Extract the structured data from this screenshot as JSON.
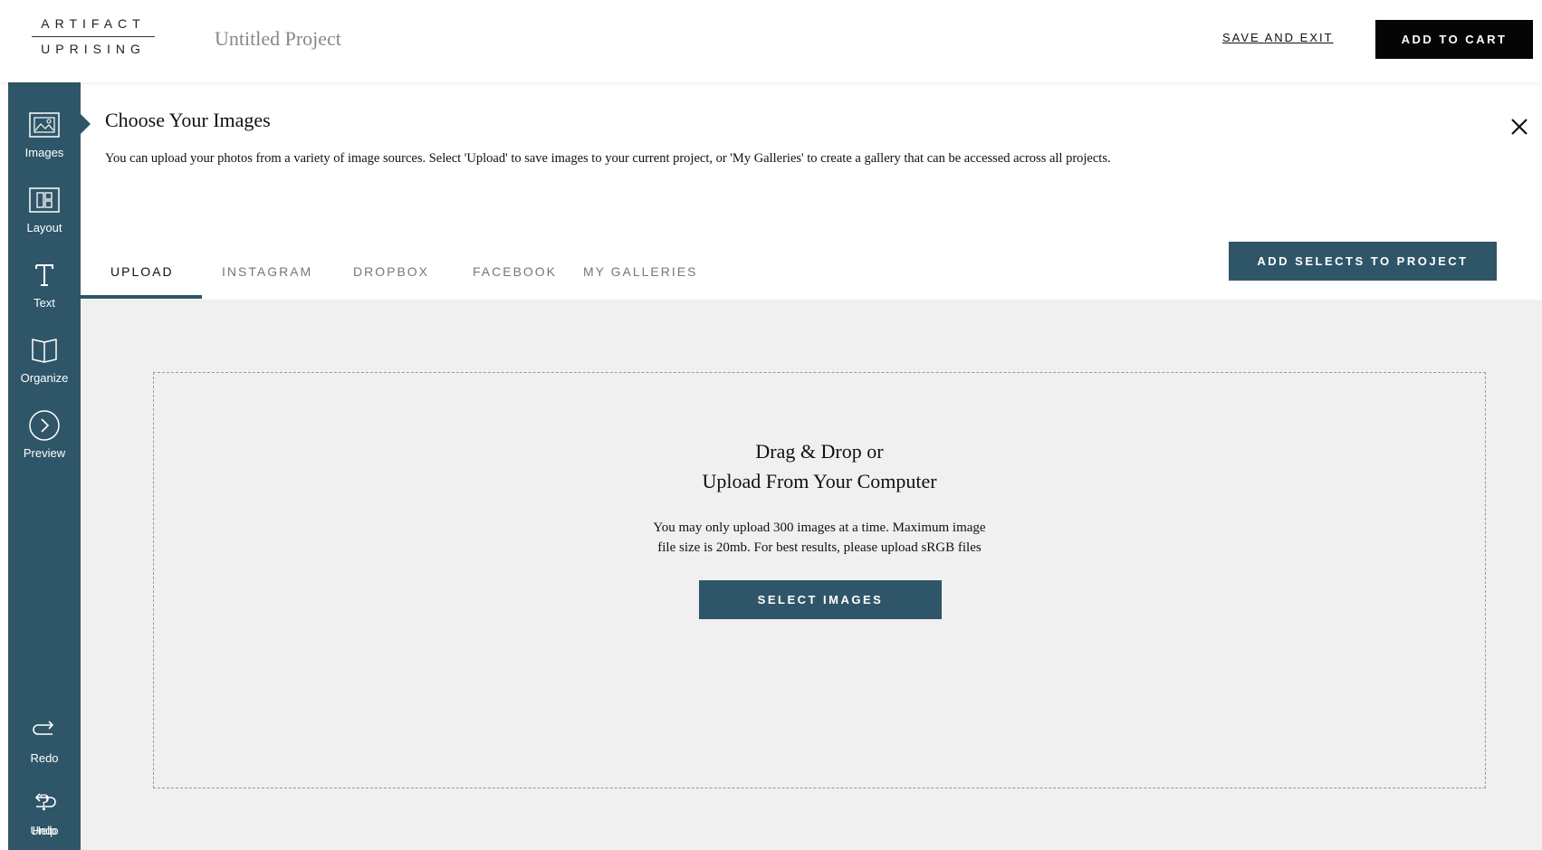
{
  "brand": {
    "logo_top": "ARTIFACT",
    "logo_bottom": "UPRISING"
  },
  "header": {
    "project_title": "Untitled Project",
    "save_exit_label": "SAVE AND EXIT",
    "add_to_cart_label": "ADD TO CART"
  },
  "sidebar": {
    "items": [
      {
        "label": "Images",
        "icon": "image-icon"
      },
      {
        "label": "Layout",
        "icon": "layout-icon"
      },
      {
        "label": "Text",
        "icon": "text-icon"
      },
      {
        "label": "Organize",
        "icon": "book-icon"
      },
      {
        "label": "Preview",
        "icon": "preview-icon"
      },
      {
        "label": "Redo",
        "icon": "redo-icon"
      },
      {
        "label": "Undo",
        "icon": "undo-icon"
      },
      {
        "label": "Help",
        "icon": "help-icon"
      }
    ],
    "active_item": "Images"
  },
  "panel": {
    "title": "Choose Your Images",
    "description": "You can upload your photos from a variety of image sources. Select 'Upload' to save images to your current project, or 'My Galleries' to create a gallery that can be accessed across all projects.",
    "tabs": [
      "UPLOAD",
      "INSTAGRAM",
      "DROPBOX",
      "FACEBOOK",
      "MY GALLERIES"
    ],
    "active_tab": "UPLOAD",
    "add_selects_label": "ADD SELECTS TO PROJECT"
  },
  "dropzone": {
    "heading_line1": "Drag & Drop or",
    "heading_line2": "Upload From Your Computer",
    "note_line1": "You may only upload 300 images at a time. Maximum image",
    "note_line2": "file size is 20mb. For best results, please upload sRGB files",
    "select_label": "SELECT IMAGES"
  },
  "colors": {
    "accent": "#2f5668",
    "cart_button": "#050505",
    "upload_background": "#f0f0f0"
  }
}
